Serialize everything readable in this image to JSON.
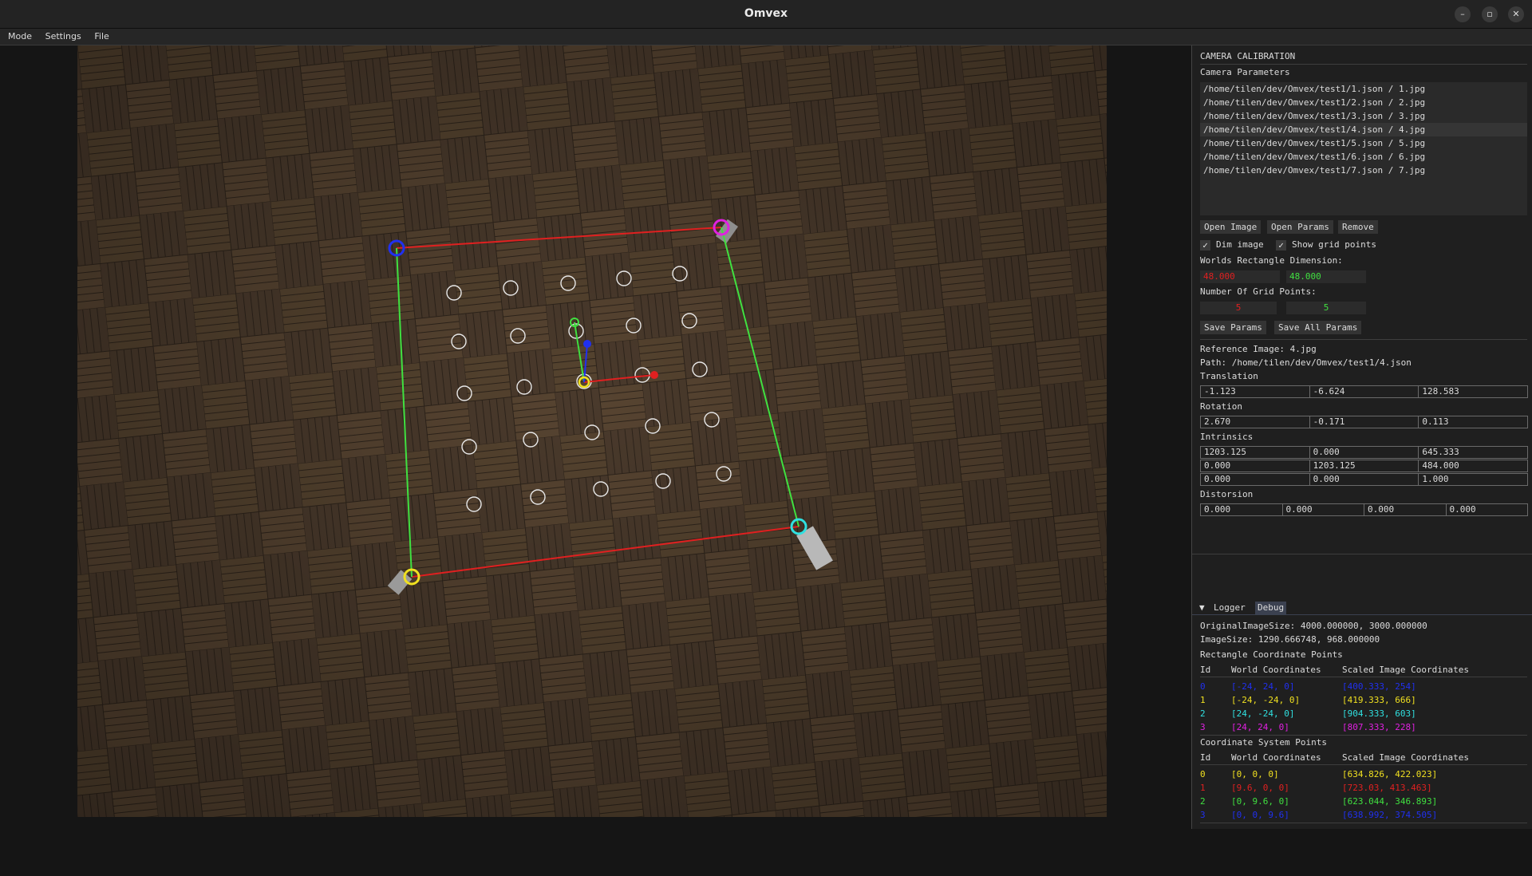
{
  "window": {
    "title": "Omvex",
    "controls": [
      "–",
      "▫",
      "✕"
    ]
  },
  "menu": [
    "Mode",
    "Settings",
    "File"
  ],
  "colors": {
    "red": "#e02020",
    "green": "#40e040",
    "blue": "#2030f0",
    "yellow": "#f0e020",
    "cyan": "#30e0e0",
    "magenta": "#e020e0"
  },
  "panel": {
    "section_title": "CAMERA CALIBRATION",
    "camera_params_label": "Camera Parameters",
    "files": [
      "/home/tilen/dev/Omvex/test1/1.json / 1.jpg",
      "/home/tilen/dev/Omvex/test1/2.json / 2.jpg",
      "/home/tilen/dev/Omvex/test1/3.json / 3.jpg",
      "/home/tilen/dev/Omvex/test1/4.json / 4.jpg",
      "/home/tilen/dev/Omvex/test1/5.json / 5.jpg",
      "/home/tilen/dev/Omvex/test1/6.json / 6.jpg",
      "/home/tilen/dev/Omvex/test1/7.json / 7.jpg"
    ],
    "selected_file_index": 3,
    "buttons": {
      "open_image": "Open Image",
      "open_params": "Open Params",
      "remove": "Remove",
      "save_params": "Save Params",
      "save_all_params": "Save All Params"
    },
    "dim_image": "Dim image",
    "show_grid_points": "Show grid points",
    "checked": "✓",
    "worlds_rect_label": "Worlds Rectangle Dimension:",
    "world_w": "48.000",
    "world_h": "48.000",
    "grid_points_label": "Number Of Grid Points:",
    "grid_x": "5",
    "grid_y": "5",
    "reference_image": "Reference Image: 4.jpg",
    "path": "Path: /home/tilen/dev/Omvex/test1/4.json",
    "translation_label": "Translation",
    "translation": [
      "-1.123",
      "-6.624",
      "128.583"
    ],
    "rotation_label": "Rotation",
    "rotation": [
      "2.670",
      "-0.171",
      "0.113"
    ],
    "intrinsics_label": "Intrinsics",
    "intrinsics": [
      [
        "1203.125",
        "0.000",
        "645.333"
      ],
      [
        "0.000",
        "1203.125",
        "484.000"
      ],
      [
        "0.000",
        "0.000",
        "1.000"
      ]
    ],
    "distortion_label": "Distorsion",
    "distortion": [
      "0.000",
      "0.000",
      "0.000",
      "0.000"
    ]
  },
  "log": {
    "collapse_icon": "▼",
    "tabs": [
      "Logger",
      "Debug"
    ],
    "original_size": "OriginalImageSize: 4000.000000, 3000.000000",
    "image_size": "ImageSize: 1290.666748, 968.000000",
    "rect_title": "Rectangle Coordinate Points",
    "headers": [
      "Id",
      "World Coordinates",
      "Scaled Image Coordinates"
    ],
    "rect_rows": [
      {
        "id": "0",
        "world": "[-24, 24, 0]",
        "image": "[400.333, 254]",
        "color": "#2030f0"
      },
      {
        "id": "1",
        "world": "[-24, -24, 0]",
        "image": "[419.333, 666]",
        "color": "#f0e020"
      },
      {
        "id": "2",
        "world": "[24, -24, 0]",
        "image": "[904.333, 603]",
        "color": "#30e0e0"
      },
      {
        "id": "3",
        "world": "[24, 24, 0]",
        "image": "[807.333, 228]",
        "color": "#e020e0"
      }
    ],
    "coord_title": "Coordinate System Points",
    "coord_rows": [
      {
        "id": "0",
        "world": "[0, 0, 0]",
        "image": "[634.826, 422.023]",
        "color": "#f0e020"
      },
      {
        "id": "1",
        "world": "[9.6, 0, 0]",
        "image": "[723.03, 413.463]",
        "color": "#e02020"
      },
      {
        "id": "2",
        "world": "[0, 9.6, 0]",
        "image": "[623.044, 346.893]",
        "color": "#40e040"
      },
      {
        "id": "3",
        "world": "[0, 0, 9.6]",
        "image": "[638.992, 374.505]",
        "color": "#2030f0"
      }
    ]
  }
}
